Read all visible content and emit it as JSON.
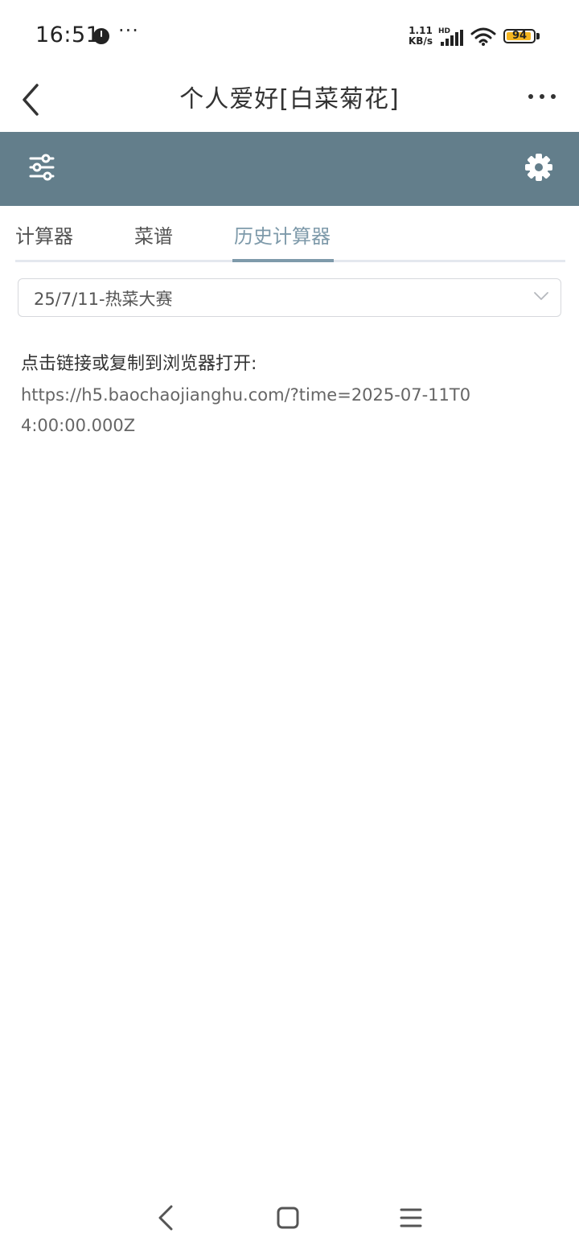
{
  "status_bar": {
    "time": "16:51",
    "more": "···",
    "net_speed_value": "1.11",
    "net_speed_unit": "KB/s",
    "hd": "HD",
    "battery": "94",
    "battery_level": 0.94,
    "battery_color": "#f5b51f"
  },
  "nav": {
    "title": "个人爱好[白菜菊花]"
  },
  "toolbar": {
    "background_color": "#637e8b"
  },
  "tabs": [
    {
      "label": "计算器"
    },
    {
      "label": "菜谱"
    },
    {
      "label": "历史计算器",
      "active": true
    }
  ],
  "select": {
    "value": "25/7/11-热菜大赛"
  },
  "content": {
    "instruction": "点击链接或复制到浏览器打开:",
    "link": "https://h5.baochaojianghu.com/?time=2025-07-11T04:00:00.000Z"
  },
  "accent_color": "#7e9aaa"
}
